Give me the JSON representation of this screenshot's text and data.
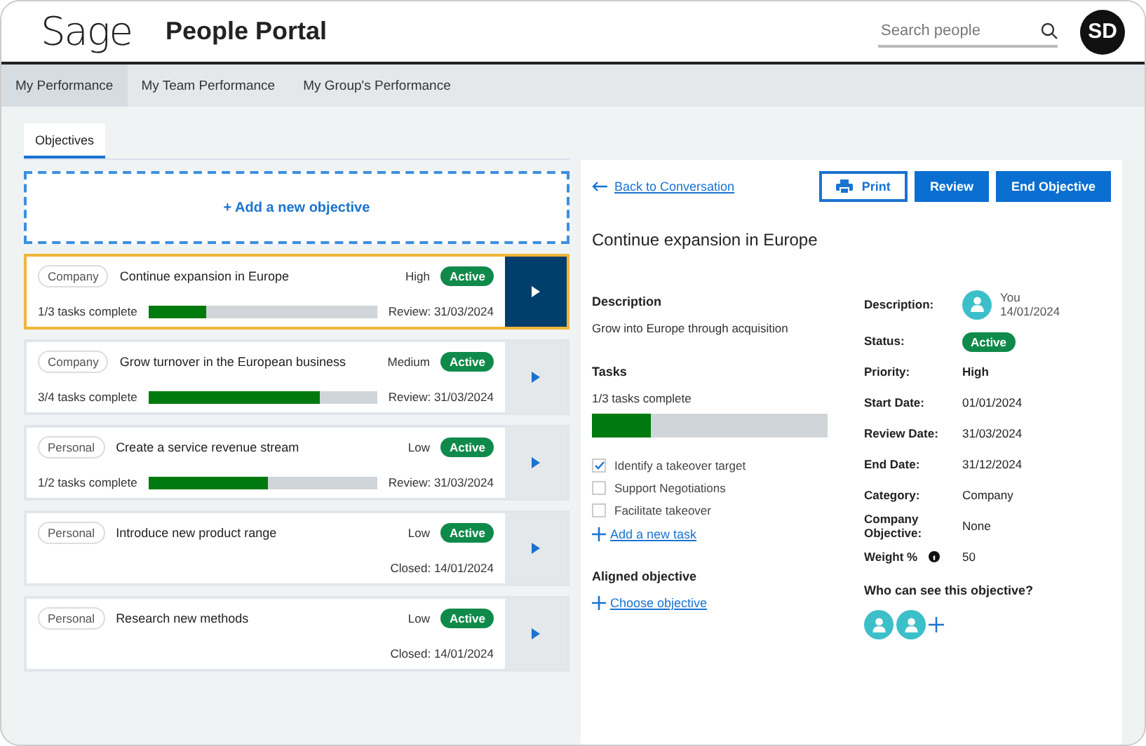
{
  "header": {
    "logo": "Sage",
    "title": "People Portal",
    "search": {
      "placeholder": "Search people"
    },
    "avatar": "SD"
  },
  "nav": [
    {
      "label": "My Performance",
      "selected": true
    },
    {
      "label": "My Team Performance",
      "selected": false
    },
    {
      "label": "My Group's Performance",
      "selected": false
    }
  ],
  "tabs": [
    {
      "label": "Objectives",
      "selected": true
    }
  ],
  "add_objective": "+ Add a new objective",
  "objectives": [
    {
      "category": "Company",
      "title": "Continue expansion in Europe",
      "priority": "High",
      "status": "Active",
      "progress": "1/3 tasks complete",
      "level": 0.25,
      "date": "Review: 31/03/2024",
      "selected": true
    },
    {
      "category": "Company",
      "title": "Grow turnover in the European business",
      "priority": "Medium",
      "status": "Active",
      "progress": "3/4 tasks complete",
      "level": 0.75,
      "date": "Review: 31/03/2024",
      "selected": false
    },
    {
      "category": "Personal",
      "title": "Create a service revenue stream",
      "priority": "Low",
      "status": "Active",
      "progress": "1/2 tasks complete",
      "level": 0.52,
      "date": "Review: 31/03/2024",
      "selected": false
    },
    {
      "category": "Personal",
      "title": "Introduce new product range",
      "priority": "Low",
      "status": "Active",
      "date": "Closed: 14/01/2024",
      "selected": false
    },
    {
      "category": "Personal",
      "title": "Research new methods",
      "priority": "Low",
      "status": "Active",
      "date": "Closed: 14/01/2024",
      "selected": false
    }
  ],
  "detail": {
    "back_link": "Back to Conversation",
    "buttons": [
      {
        "label": "Print",
        "kind": "outline"
      },
      {
        "label": "Review",
        "kind": "primary"
      },
      {
        "label": "End Objective",
        "kind": "primary"
      }
    ],
    "title": "Continue expansion in Europe",
    "description_heading": "Description",
    "description": "Grow into Europe through acquisition",
    "tasks_heading": "Tasks",
    "tasks_progress": "1/3 tasks complete",
    "level": 0.25,
    "tasks": [
      {
        "label": "Identify a takeover target",
        "checked": true
      },
      {
        "label": "Support Negotiations",
        "checked": false
      },
      {
        "label": "Facilitate takeover",
        "checked": false
      }
    ],
    "add_task": "Add a new task",
    "aligned_heading": "Aligned objective",
    "choose_objective": "Choose objective",
    "fields": [
      {
        "label": "Description:",
        "kind": "author",
        "name": "You",
        "value": "14/01/2024"
      },
      {
        "label": "Status:",
        "kind": "badge",
        "value": "Active"
      },
      {
        "label": "Priority:",
        "kind": "text",
        "value": "High"
      },
      {
        "label": "Start Date:",
        "kind": "text",
        "value": "01/01/2024"
      },
      {
        "label": "Review Date:",
        "kind": "text",
        "value": "31/03/2024"
      },
      {
        "label": "End Date:",
        "kind": "text",
        "value": "31/12/2024"
      },
      {
        "label": "Category:",
        "kind": "text",
        "value": "Company"
      },
      {
        "label": "Company Objective:",
        "kind": "text",
        "value": "None"
      },
      {
        "label": "Weight %",
        "kind": "info",
        "value": "50"
      }
    ],
    "visibility_heading": "Who can see this objective?"
  }
}
